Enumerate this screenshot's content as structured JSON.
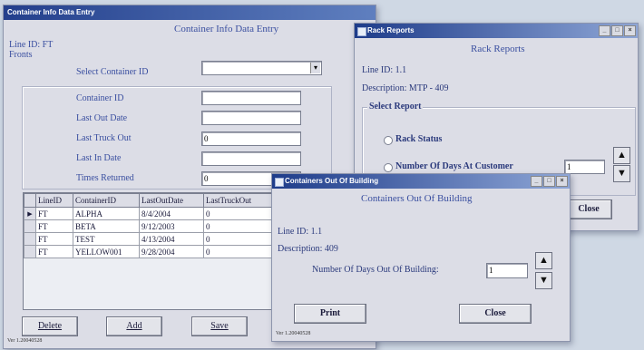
{
  "entry": {
    "title": "Container Info Data Entry",
    "heading": "Container Info Data Entry",
    "line_id_label": "Line ID: FT",
    "line_id_sub": "Fronts",
    "select_container_label": "Select Container ID",
    "select_container_value": "",
    "fields": [
      {
        "label": "Container ID",
        "value": ""
      },
      {
        "label": "Last Out Date",
        "value": ""
      },
      {
        "label": "Last Truck Out",
        "value": "0"
      },
      {
        "label": "Last In Date",
        "value": ""
      },
      {
        "label": "Times Returned",
        "value": "0"
      }
    ],
    "grid_headers": [
      "LineID",
      "ContainerID",
      "LastOutDate",
      "LastTruckOut"
    ],
    "grid_rows": [
      {
        "line": "FT",
        "container": "ALPHA",
        "date": "8/4/2004",
        "truck": "0"
      },
      {
        "line": "FT",
        "container": "BETA",
        "date": "9/12/2003",
        "truck": "0"
      },
      {
        "line": "FT",
        "container": "TEST",
        "date": "4/13/2004",
        "truck": "0"
      },
      {
        "line": "FT",
        "container": "YELLOW001",
        "date": "9/28/2004",
        "truck": "0"
      }
    ],
    "row_pointer": "▶",
    "buttons": {
      "delete": "Delete",
      "add": "Add",
      "save": "Save"
    },
    "status": "Ver 1.20040528"
  },
  "rack": {
    "title": "Rack Reports",
    "heading": "Rack Reports",
    "line_id": "Line ID: 1.1",
    "description": "Description: MTP - 409",
    "group_label": "Select Report",
    "radio_rack_status": "Rack Status",
    "radio_days_customer": "Number Of Days At Customer",
    "days_value": "1",
    "close_label": "Close",
    "controls": [
      "_",
      "□",
      "×"
    ]
  },
  "out": {
    "title": "Containers Out Of Building",
    "heading": "Containers Out Of Building",
    "line_id": "Line ID: 1.1",
    "description": "Description: 409",
    "days_label": "Number Of Days Out Of Building:",
    "days_value": "1",
    "print_label": "Print",
    "close_label": "Close",
    "status": "Ver 1.20040528",
    "controls": [
      "_",
      "□",
      "×"
    ]
  },
  "icons": {
    "up": "▲",
    "down": "▼",
    "dropdown": "▾"
  }
}
